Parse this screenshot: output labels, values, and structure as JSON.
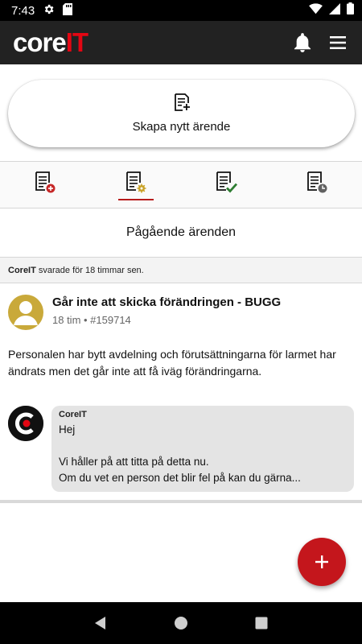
{
  "status_bar": {
    "time": "7:43"
  },
  "app": {
    "logo_core": "core",
    "logo_it": "IT"
  },
  "create": {
    "label": "Skapa nytt ärende"
  },
  "filters": [
    {
      "name": "new",
      "badge_color": "#c62828"
    },
    {
      "name": "in-progress",
      "badge_color": "#c9a227"
    },
    {
      "name": "resolved",
      "badge_color": "#2e7d32"
    },
    {
      "name": "history",
      "badge_color": "#616161"
    }
  ],
  "section": {
    "title": "Pågående ärenden"
  },
  "replied_notice": {
    "author": "CoreIT",
    "text": " svarade för 18 timmar sen."
  },
  "ticket": {
    "title": "Går inte att skicka förändringen - BUGG",
    "meta": "18 tim • #159714",
    "description": "Personalen har bytt avdelning och förutsättningarna för larmet har ändrats men det går inte att få iväg förändringarna.",
    "reply": {
      "author": "CoreIT",
      "text": "Hej\n\nVi håller på att titta på detta nu.\nOm du vet en person det blir fel på kan du gärna..."
    }
  },
  "colors": {
    "accent": "#c4161c",
    "app_bar": "#222222",
    "avatar": "#c9a93a"
  }
}
